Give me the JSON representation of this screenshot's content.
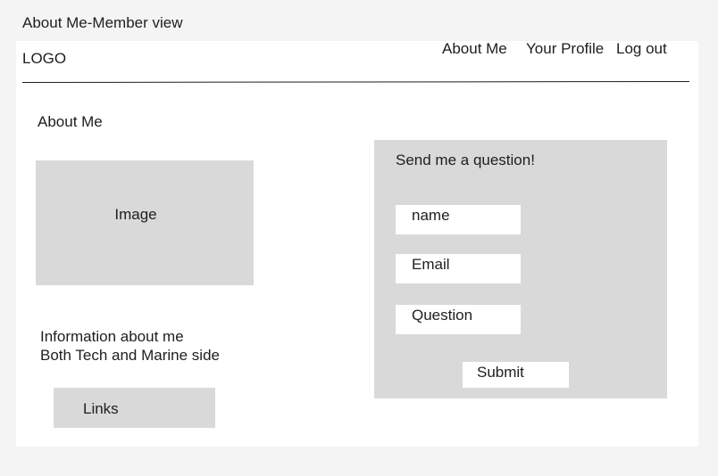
{
  "frame_title": "About Me-Member view",
  "header": {
    "logo": "LOGO",
    "nav": {
      "about_me": "About Me",
      "your_profile": "Your Profile",
      "log_out": "Log out"
    }
  },
  "main": {
    "heading": "About Me",
    "image_placeholder": "Image",
    "info_line1": "Information about me",
    "info_line2": "Both Tech and Marine side",
    "links_label": "Links"
  },
  "question_form": {
    "title": "Send me a question!",
    "name_placeholder": "name",
    "email_placeholder": "Email",
    "question_placeholder": "Question",
    "submit_label": "Submit"
  }
}
